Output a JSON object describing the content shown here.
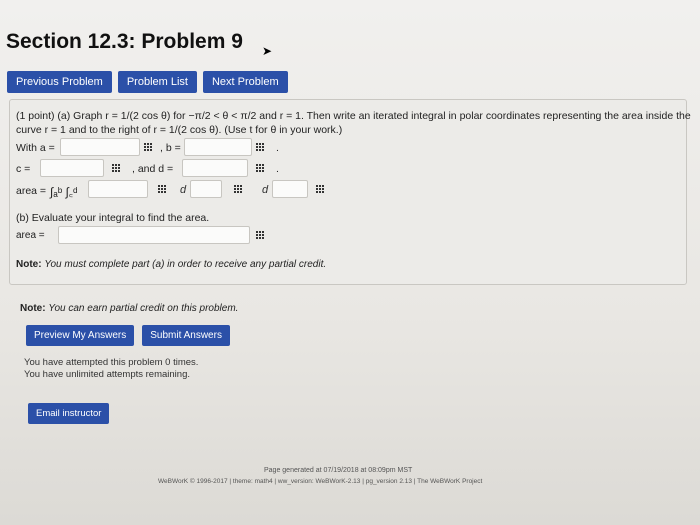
{
  "page": {
    "title": "Section 12.3: Problem 9"
  },
  "nav": {
    "previous": "Previous Problem",
    "list": "Problem List",
    "next": "Next Problem"
  },
  "problem": {
    "line1": "(1 point) (a) Graph r = 1/(2 cos θ) for −π/2 < θ < π/2 and r = 1. Then write an iterated integral in polar coordinates representing the area inside the",
    "line2": "curve r = 1 and to the right of r = 1/(2 cos θ). (Use t for θ in your work.)",
    "with_a": "With a =",
    "b_eq": ", b =",
    "c_eq": "c =",
    "d_eq": ", and d =",
    "period": ".",
    "area_label": "area =",
    "integral_expr": "∫ₐᵇ ∫꜀ᵈ",
    "d1": "d",
    "d2": "d",
    "part_b": "(b) Evaluate your integral to find the area.",
    "area_label2": "area =",
    "note_label": "Note:",
    "note_text": "You must complete part (a) in order to receive any partial credit."
  },
  "credit_note": {
    "label": "Note:",
    "text": "You can earn partial credit on this problem."
  },
  "actions": {
    "preview": "Preview My Answers",
    "submit": "Submit Answers"
  },
  "attempts": {
    "line1": "You have attempted this problem 0 times.",
    "line2": "You have unlimited attempts remaining."
  },
  "email": "Email instructor",
  "footer": {
    "line1": "Page generated at 07/19/2018 at 08:09pm MST",
    "line2": "WeBWorK © 1996-2017 | theme: math4 | ww_version: WeBWorK-2.13 | pg_version 2.13 | The WeBWorK Project"
  }
}
